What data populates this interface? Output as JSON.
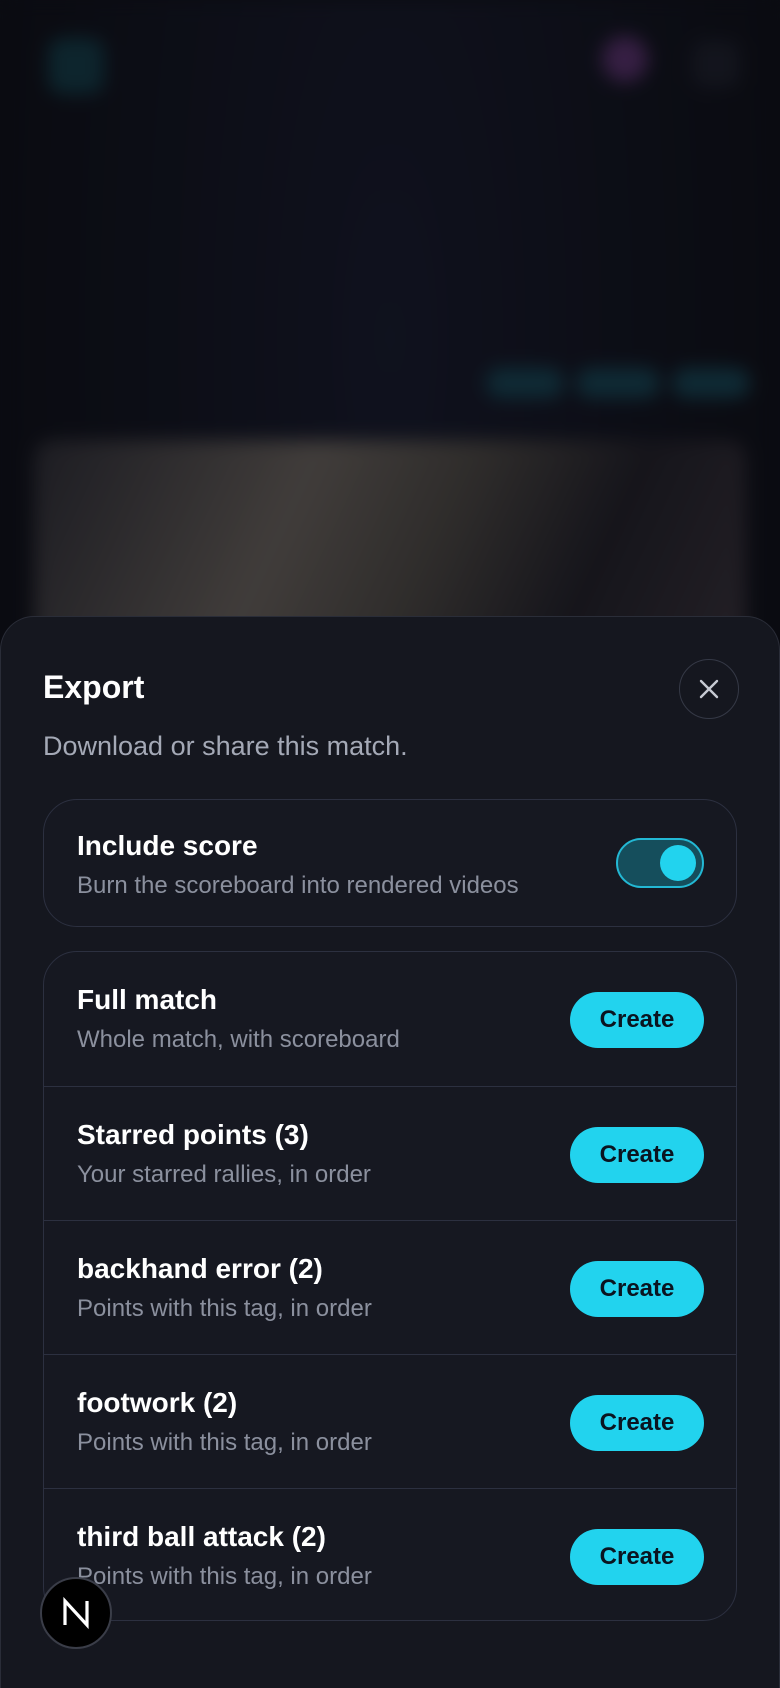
{
  "sheet": {
    "title": "Export",
    "subtitle": "Download or share this match.",
    "close_icon": "close-icon"
  },
  "score_option": {
    "title": "Include score",
    "description": "Burn the scoreboard into rendered videos",
    "enabled": true
  },
  "exports": [
    {
      "title": "Full match",
      "description": "Whole match, with scoreboard",
      "button": "Create"
    },
    {
      "title": "Starred points (3)",
      "description": "Your starred rallies, in order",
      "button": "Create"
    },
    {
      "title": "backhand error (2)",
      "description": "Points with this tag, in order",
      "button": "Create"
    },
    {
      "title": "footwork (2)",
      "description": "Points with this tag, in order",
      "button": "Create"
    },
    {
      "title": "third ball attack (2)",
      "description": "Points with this tag, in order",
      "button": "Create"
    }
  ],
  "badge": {
    "label": "N"
  },
  "colors": {
    "accent": "#22d3ee",
    "sheet_bg": "#15171f",
    "border": "#2c3040",
    "muted_text": "#8b909e"
  }
}
